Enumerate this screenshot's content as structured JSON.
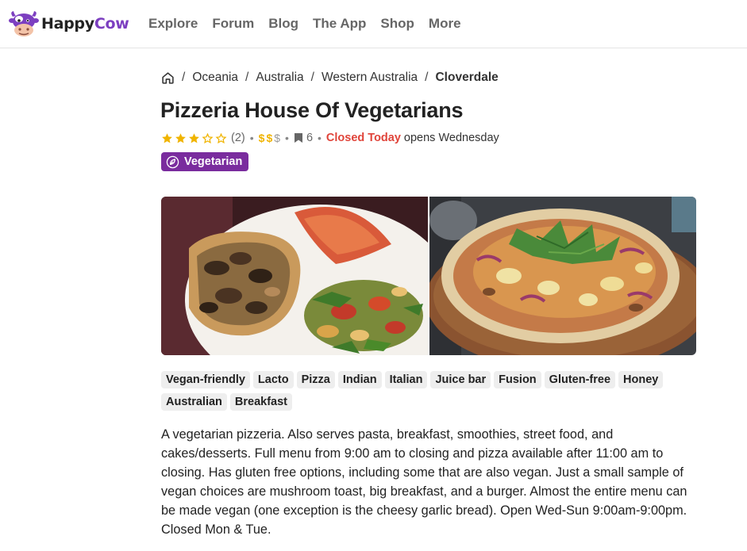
{
  "brand": {
    "name_part1": "Happy",
    "name_part2": "Cow",
    "accent": "#7c3fc0"
  },
  "nav": {
    "items": [
      "Explore",
      "Forum",
      "Blog",
      "The App",
      "Shop",
      "More"
    ]
  },
  "breadcrumb": {
    "items": [
      "Oceania",
      "Australia",
      "Western Australia"
    ],
    "current": "Cloverdale"
  },
  "listing": {
    "title": "Pizzeria House Of Vegetarians",
    "rating": 3,
    "rating_max": 5,
    "rating_count": "(2)",
    "price_level": 2,
    "price_symbols": [
      "$",
      "$",
      "$"
    ],
    "bookmarks": "6",
    "status": "Closed Today",
    "status_color": "#e0443a",
    "opens": "opens Wednesday",
    "category_badge": "Vegetarian",
    "badge_color": "#7a2c9e"
  },
  "tags": [
    "Vegan-friendly",
    "Lacto",
    "Pizza",
    "Indian",
    "Italian",
    "Juice bar",
    "Fusion",
    "Gluten-free",
    "Honey",
    "Australian",
    "Breakfast"
  ],
  "description": "A vegetarian pizzeria. Also serves pasta, breakfast, smoothies, street food, and cakes/desserts. Full menu from 9:00 am to closing and pizza available after 11:00 am to closing. Has gluten free options, including some that are also vegan. Just a small sample of vegan choices are mushroom toast, big breakfast, and a burger. Almost the entire menu can be made vegan (one exception is the cheesy garlic bread). Open Wed-Sun 9:00am-9:00pm. Closed Mon & Tue."
}
